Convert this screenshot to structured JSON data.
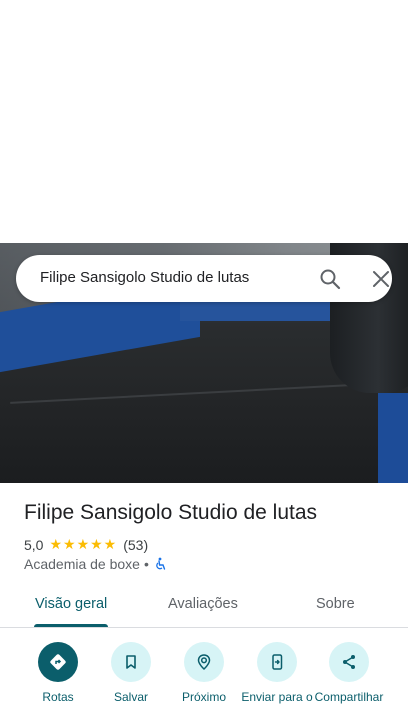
{
  "search": {
    "query": "Filipe Sansigolo Studio de lutas"
  },
  "place": {
    "name": "Filipe Sansigolo Studio de lutas",
    "rating": "5,0",
    "stars": "★★★★★",
    "review_count": "(53)",
    "category": "Academia de boxe",
    "separator": "•"
  },
  "tabs": [
    {
      "label": "Visão geral",
      "active": true
    },
    {
      "label": "Avaliações",
      "active": false
    },
    {
      "label": "Sobre",
      "active": false
    }
  ],
  "actions": [
    {
      "label": "Rotas",
      "icon": "directions-icon"
    },
    {
      "label": "Salvar",
      "icon": "bookmark-icon"
    },
    {
      "label": "Próximo",
      "icon": "nearby-icon"
    },
    {
      "label": "Enviar para o",
      "icon": "send-to-phone-icon"
    },
    {
      "label": "Compartilhar",
      "icon": "share-icon"
    }
  ],
  "colors": {
    "accent": "#0b5e6b",
    "action_bg": "#d7f4f6",
    "star": "#fbbc04",
    "text_primary": "#202124",
    "text_secondary": "#5f6368"
  }
}
